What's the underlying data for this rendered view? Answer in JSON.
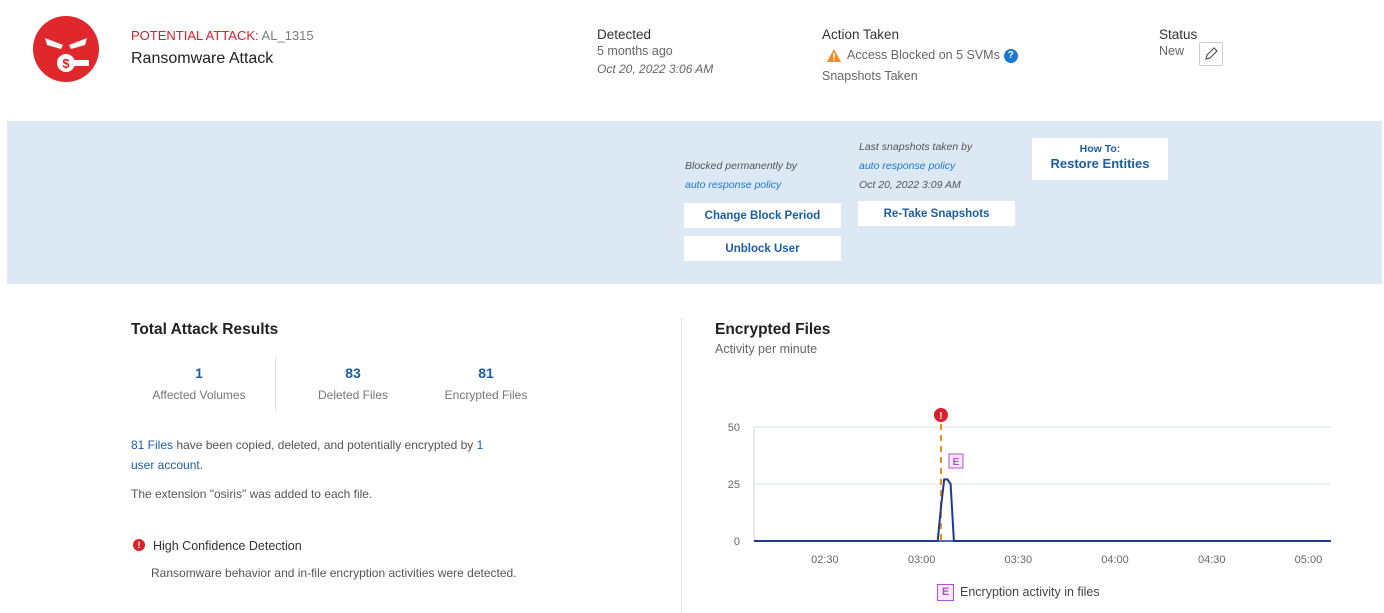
{
  "header": {
    "attack_keyword": "POTENTIAL ATTACK:",
    "attack_id": "AL_1315",
    "attack_title": "Ransomware Attack",
    "detected": {
      "label": "Detected",
      "relative": "5 months ago",
      "timestamp": "Oct 20, 2022 3:06 AM"
    },
    "action_taken": {
      "label": "Action Taken",
      "blocked_text": "Access Blocked on 5 SVMs",
      "help_glyph": "?",
      "snapshots_text": "Snapshots Taken"
    },
    "status": {
      "label": "Status",
      "value": "New"
    }
  },
  "action_band": {
    "blocked_note": "Blocked permanently by",
    "blocked_link": "auto response policy",
    "change_block_button": "Change Block Period",
    "unblock_button": "Unblock User",
    "snapshot_note": "Last snapshots taken by",
    "snapshot_link": "auto response policy",
    "snapshot_time": "Oct 20, 2022 3:09 AM",
    "retake_button": "Re-Take Snapshots",
    "howto_line1": "How To:",
    "howto_line2": "Restore Entities"
  },
  "results": {
    "title": "Total Attack Results",
    "stats": [
      {
        "value": "1",
        "label": "Affected Volumes"
      },
      {
        "value": "83",
        "label": "Deleted Files"
      },
      {
        "value": "81",
        "label": "Encrypted Files"
      }
    ],
    "summary_link1": "81 Files",
    "summary_text1": " have been copied, deleted, and potentially encrypted by ",
    "summary_link2_a": "1",
    "summary_link2_b": "user account",
    "summary_end": ".",
    "extension_text": "The extension \"osiris\" was added to each file.",
    "confidence_title": "High Confidence Detection",
    "confidence_text": "Ransomware behavior and in-file encryption activities were detected."
  },
  "chart_data": {
    "type": "line",
    "title": "Encrypted Files",
    "subtitle": "Activity per minute",
    "xlabel": "",
    "ylabel": "",
    "x_tick_labels": [
      "02:30",
      "03:00",
      "03:30",
      "04:00",
      "04:30",
      "05:00"
    ],
    "y_ticks": [
      0,
      25,
      50
    ],
    "ylim": [
      0,
      50
    ],
    "xlim_minutes": [
      "02:08",
      "05:07"
    ],
    "grid": "horizontal",
    "series": [
      {
        "x": [
          "02:08",
          "03:05",
          "03:06",
          "03:07",
          "03:08",
          "03:09",
          "03:10",
          "05:07"
        ],
        "values": [
          0,
          0,
          15,
          27,
          27,
          25,
          0,
          0
        ]
      }
    ],
    "event_markers": [
      {
        "time": "03:06",
        "kind": "attack-detected",
        "glyph": "!"
      },
      {
        "time": "03:06",
        "kind": "encryption-activity",
        "glyph": "E"
      }
    ],
    "legend": [
      {
        "glyph": "E",
        "label": "Encryption activity in files"
      }
    ],
    "colors": {
      "line": "#1d3a8f",
      "event_line": "#f08a24",
      "alert": "#d9202c",
      "encryption": "#b14fd6"
    }
  }
}
